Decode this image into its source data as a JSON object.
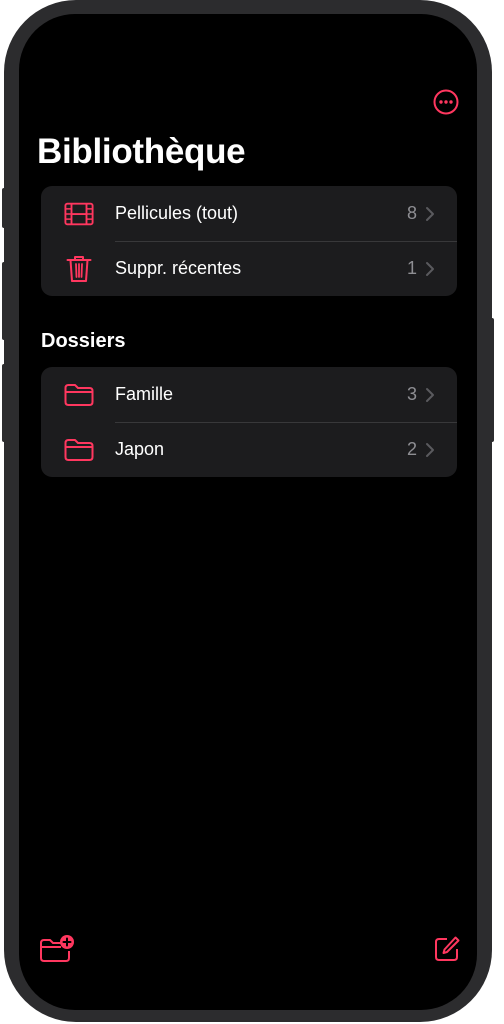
{
  "theme": {
    "accent": "#ff375f",
    "background": "#000000",
    "card": "#1c1c1e"
  },
  "header": {
    "more_icon": "ellipsis-circle-icon",
    "title": "Bibliothèque"
  },
  "library": {
    "items": [
      {
        "icon": "film-icon",
        "label": "Pellicules (tout)",
        "count": "8"
      },
      {
        "icon": "trash-icon",
        "label": "Suppr. récentes",
        "count": "1"
      }
    ]
  },
  "folders": {
    "header": "Dossiers",
    "items": [
      {
        "icon": "folder-icon",
        "label": "Famille",
        "count": "3"
      },
      {
        "icon": "folder-icon",
        "label": "Japon",
        "count": "2"
      }
    ]
  },
  "toolbar": {
    "new_folder_icon": "folder-badge-plus-icon",
    "compose_icon": "square-pencil-icon"
  }
}
